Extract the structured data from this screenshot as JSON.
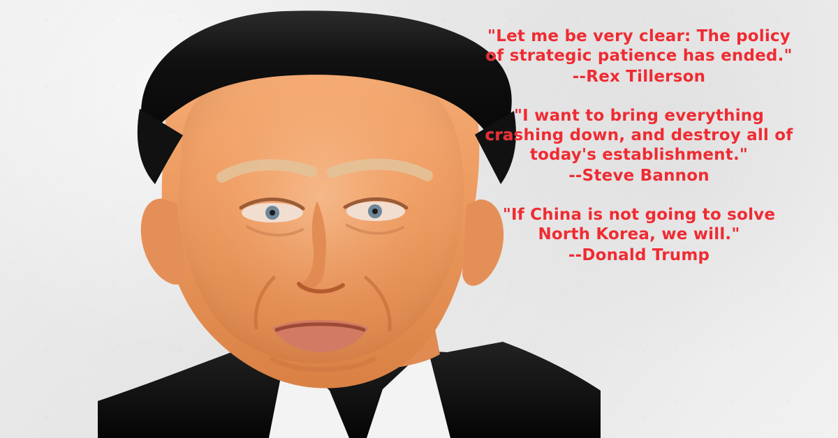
{
  "quotes": [
    {
      "text": "\"Let me be very clear: The policy\nof strategic patience has ended.\"",
      "author": "--Rex Tillerson"
    },
    {
      "text": "\"I want to bring everything\ncrashing down, and destroy all of\ntoday's establishment.\"",
      "author": "--Steve Bannon"
    },
    {
      "text": "\"If China is not going to solve\nNorth Korea, we will.\"",
      "author": "--Donald Trump"
    }
  ],
  "colors": {
    "quote_text": "#ef2b32",
    "background": "#ebebeb",
    "hair": "#121212",
    "skin": "#f0a067",
    "suit": "#111111",
    "shirt": "#f4f4f4"
  },
  "icons": {
    "portrait": "portrait-icon"
  }
}
